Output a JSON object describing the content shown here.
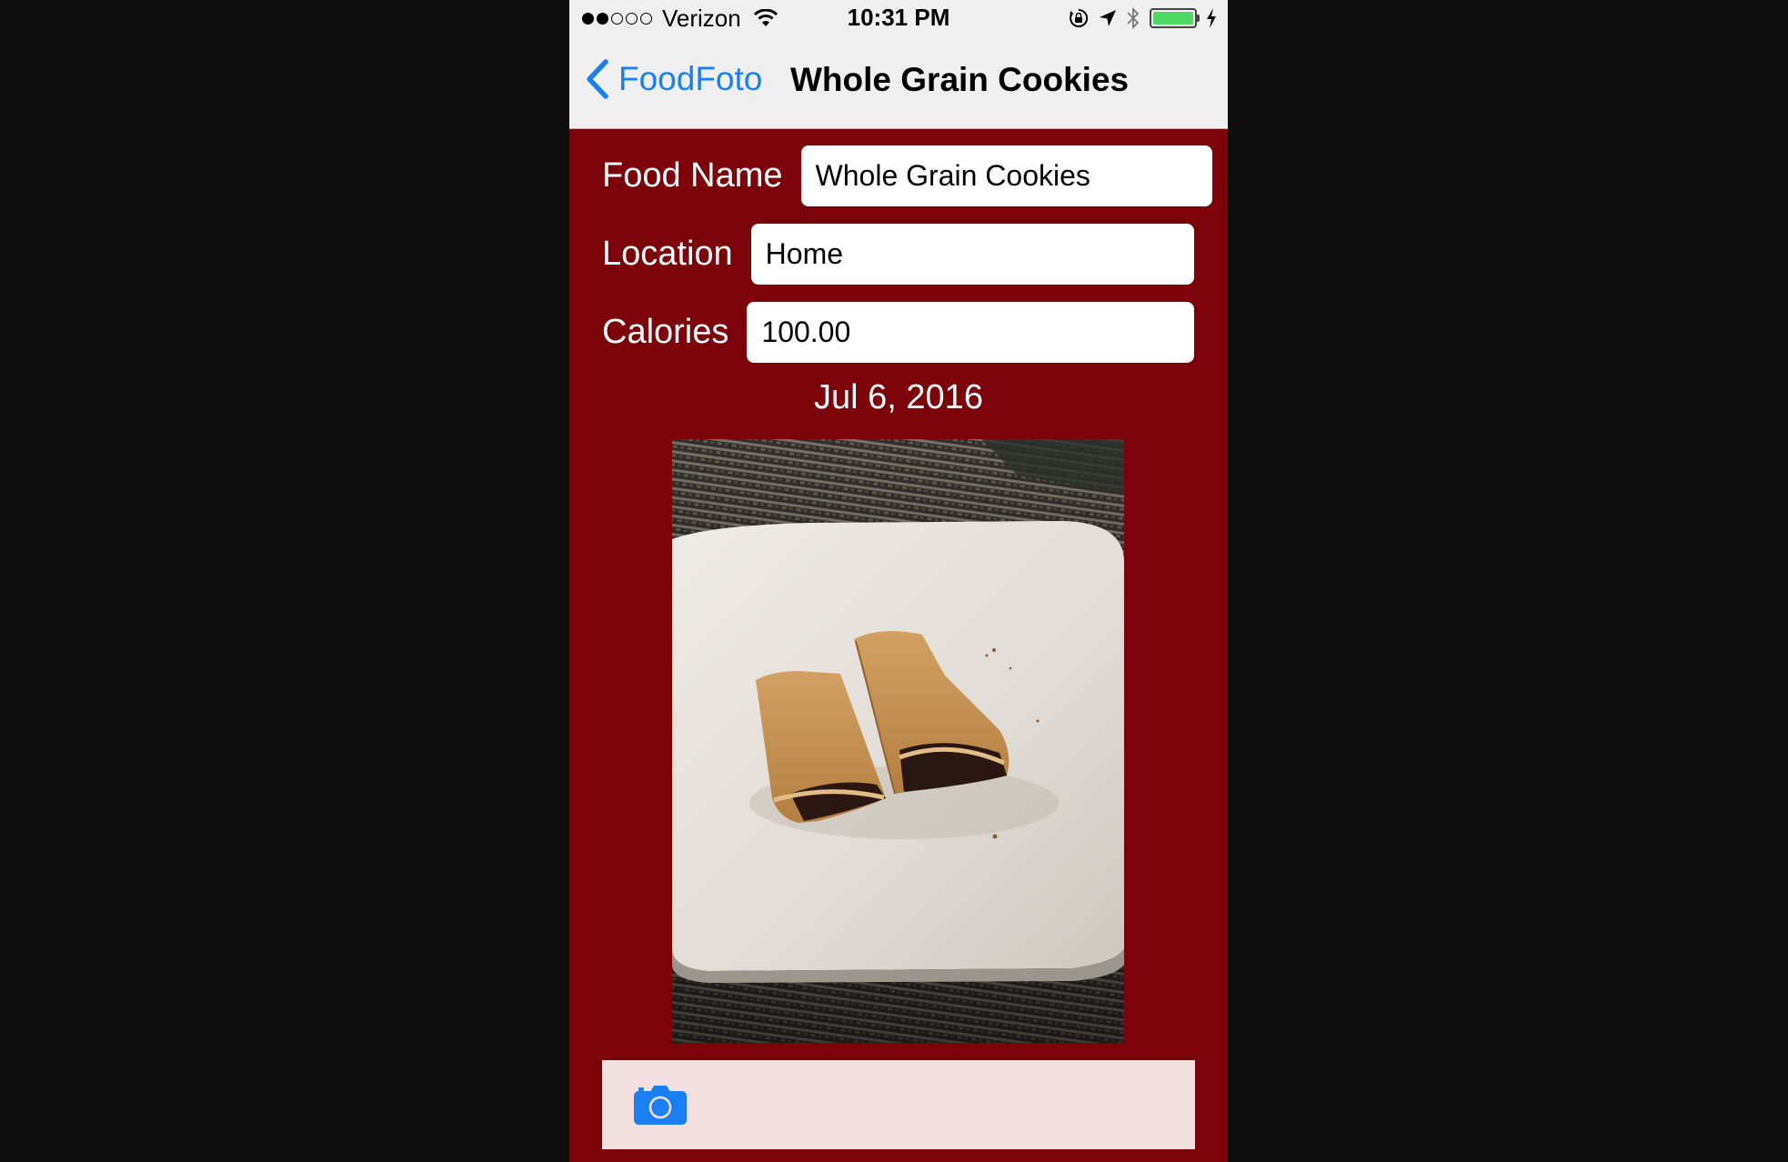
{
  "status_bar": {
    "signal_bars_filled": 2,
    "signal_bars_total": 5,
    "carrier": "Verizon",
    "time": "10:31 PM",
    "icons": [
      "wifi-icon",
      "orientation-lock-icon",
      "location-arrow-icon",
      "bluetooth-icon",
      "battery-icon",
      "charging-bolt-icon"
    ],
    "battery_level": 1.0
  },
  "nav": {
    "back_label": "FoodFoto",
    "title": "Whole Grain Cookies"
  },
  "form": {
    "food_name_label": "Food Name",
    "food_name_value": "Whole Grain Cookies",
    "location_label": "Location",
    "location_value": "Home",
    "calories_label": "Calories",
    "calories_value": "100.00",
    "date": "Jul 6, 2016"
  },
  "toolbar": {
    "icon": "camera-icon"
  },
  "colors": {
    "background": "#7b0309",
    "accent": "#1a7ff2",
    "toolbar": "#f4dfe0",
    "battery": "#4cd964"
  }
}
